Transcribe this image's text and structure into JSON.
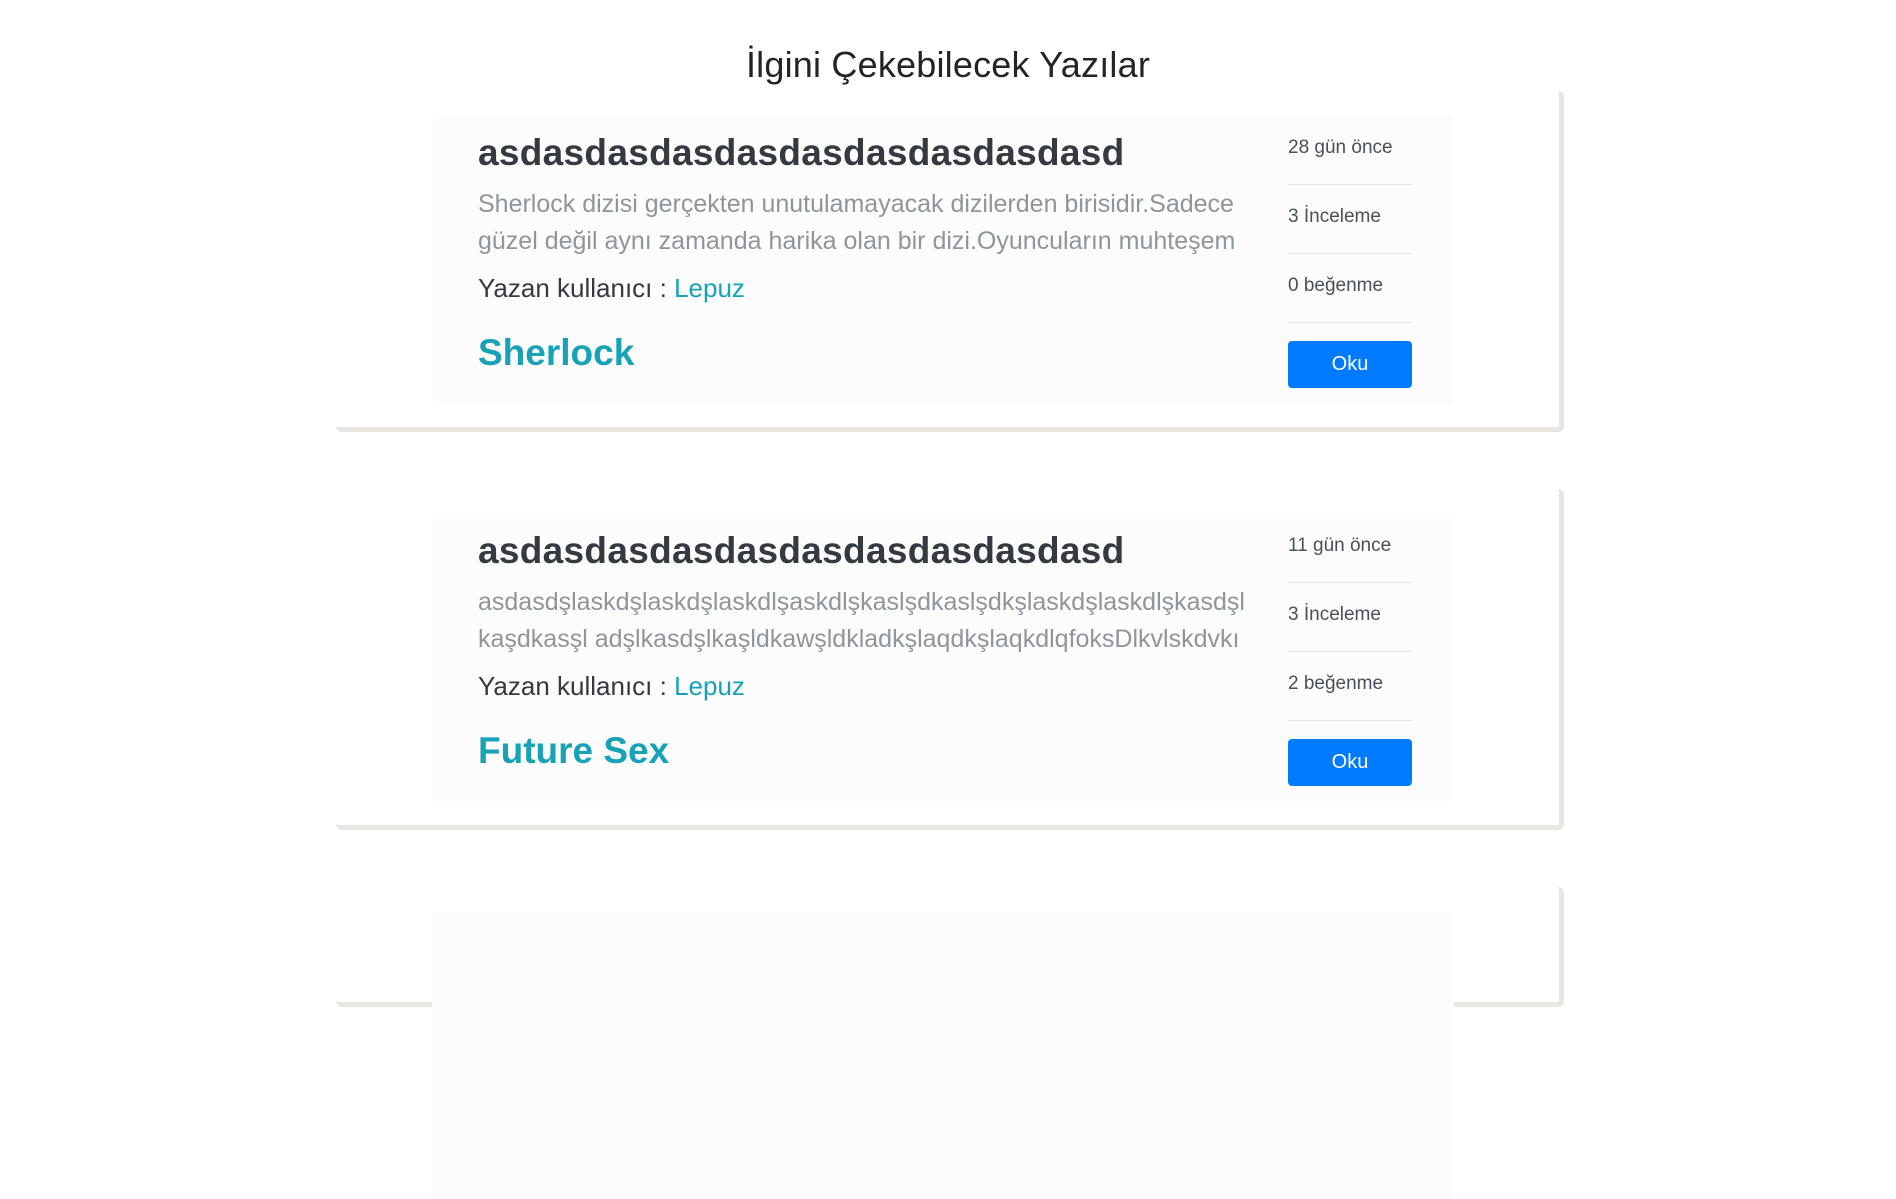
{
  "page": {
    "heading": "İlgini Çekebilecek Yazılar"
  },
  "posts": [
    {
      "title": "asdasdasdasdasdasdasdasdasdasd",
      "excerpt": "Sherlock dizisi gerçekten unutulamayacak dizilerden birisidir.Sadece güzel değil aynı zamanda harika olan bir dizi.Oyuncuların muhteşem",
      "author_prefix": "Yazan kullanıcı : ",
      "author": "Lepuz",
      "category": "Sherlock",
      "time_ago": "28 gün önce",
      "review_count": "3 İnceleme",
      "likes": "0 beğenme",
      "read_label": "Oku"
    },
    {
      "title": "asdasdasdasdasdasdasdasdasdasd",
      "excerpt": "asdasdşlaskdşlaskdşlaskdlşaskdlşkaslşdkaslşdkşlaskdşlaskdlşkasdşlkaşdkasşl adşlkasdşlkaşldkawşldkladkşlaqdkşlaqkdlqfoksDlkvlskdvkıwejfkıjvIKJVŞIJVLD",
      "author_prefix": "Yazan kullanıcı : ",
      "author": "Lepuz",
      "category": "Future Sex",
      "time_ago": "11 gün önce",
      "review_count": "3 İnceleme",
      "likes": "2 beğenme",
      "read_label": "Oku"
    }
  ],
  "colors": {
    "accent": "#17a2b8",
    "button": "#007bff",
    "card_shadow": "#e9e6e1"
  }
}
